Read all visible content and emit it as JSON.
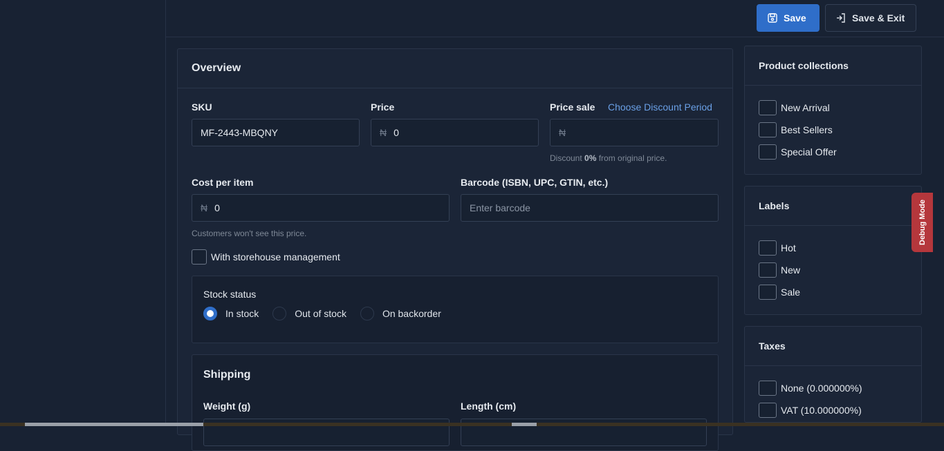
{
  "toolbar": {
    "save_label": "Save",
    "save_exit_label": "Save & Exit"
  },
  "overview": {
    "title": "Overview",
    "sku": {
      "label": "SKU",
      "value": "MF-2443-MBQNY"
    },
    "price": {
      "label": "Price",
      "currency": "₦",
      "value": "0"
    },
    "price_sale": {
      "label": "Price sale",
      "currency": "₦",
      "value": "",
      "link": "Choose Discount Period",
      "hint_prefix": "Discount ",
      "hint_value": "0%",
      "hint_suffix": " from original price."
    },
    "cost": {
      "label": "Cost per item",
      "currency": "₦",
      "value": "0",
      "hint": "Customers won't see this price."
    },
    "barcode": {
      "label": "Barcode (ISBN, UPC, GTIN, etc.)",
      "placeholder": "Enter barcode"
    },
    "storehouse_label": "With storehouse management",
    "stock": {
      "label": "Stock status",
      "options": [
        "In stock",
        "Out of stock",
        "On backorder"
      ],
      "selected": "In stock"
    },
    "shipping": {
      "title": "Shipping",
      "weight_label": "Weight (g)",
      "length_label": "Length (cm)"
    }
  },
  "collections": {
    "title": "Product collections",
    "items": [
      "New Arrival",
      "Best Sellers",
      "Special Offer"
    ]
  },
  "labels": {
    "title": "Labels",
    "items": [
      "Hot",
      "New",
      "Sale"
    ]
  },
  "taxes": {
    "title": "Taxes",
    "items": [
      "None (0.000000%)",
      "VAT (10.000000%)"
    ]
  },
  "debug_label": "Debug Mode",
  "colors": {
    "accent": "#2f6ec9",
    "link": "#6aa0e6",
    "debug": "#b5373c"
  }
}
